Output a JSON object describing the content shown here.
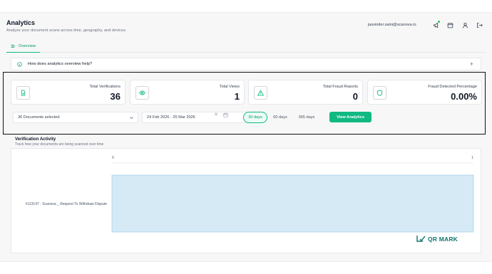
{
  "header": {
    "title": "Analytics",
    "subtitle": "Analyze your document scans across time, geography, and devices.",
    "user_email": "jasvinder.saini@scanova.io"
  },
  "top_icons": [
    "megaphone-icon",
    "calendar-icon",
    "user-icon",
    "logout-icon"
  ],
  "tabs": [
    {
      "label": "Overview",
      "icon": "chart-bars-icon",
      "active": true
    }
  ],
  "help": {
    "question": "How does analytics overview help?"
  },
  "stats": [
    {
      "label": "Total Verifications",
      "value": "36",
      "icon": "document-check-icon"
    },
    {
      "label": "Total Views",
      "value": "1",
      "icon": "eye-icon"
    },
    {
      "label": "Total Fraud Reports",
      "value": "0",
      "icon": "warning-triangle-icon"
    },
    {
      "label": "Fraud Detected Percentage",
      "value": "0.00%",
      "icon": "shield-icon"
    }
  ],
  "filters": {
    "documents_selected": "36 Documents selected",
    "date_range": "24 Feb 2026 - 25 Mar 2026",
    "ranges": [
      {
        "label": "30 days",
        "active": true
      },
      {
        "label": "60 days",
        "active": false
      },
      {
        "label": "365 days",
        "active": false
      }
    ],
    "view_button": "View Analytics"
  },
  "activity": {
    "title": "Verification Activity",
    "subtitle": "Track how your documents are being scanned over time"
  },
  "chart_data": {
    "type": "bar",
    "orientation": "horizontal",
    "categories": [
      "#113147 - Scanova _ Request To Withdraw Dispute"
    ],
    "values": [
      1
    ],
    "xlim": [
      0,
      1
    ],
    "x_ticks": [
      "0",
      "1"
    ],
    "grid": false,
    "bar_color": "#d6eaf6",
    "bar_border_color": "#8ec5e6"
  },
  "watermark": {
    "text": "QR MARK"
  },
  "colors": {
    "accent": "#10b981",
    "accent_text": "#059669"
  }
}
